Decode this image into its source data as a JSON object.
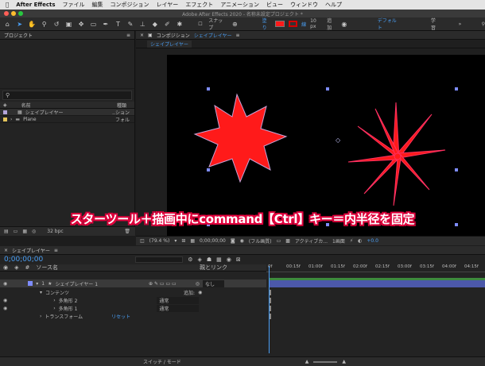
{
  "menubar": {
    "apple": "",
    "app": "After Effects",
    "items": [
      "ファイル",
      "編集",
      "コンポジション",
      "レイヤー",
      "エフェクト",
      "アニメーション",
      "ビュー",
      "ウィンドウ",
      "ヘルプ"
    ]
  },
  "title": "Adobe After Effects 2020 - 名称未設定プロジェクト *",
  "toolbar": {
    "snap": "スナップ",
    "fill_label": "塗り",
    "stroke_label": "線",
    "stroke_width": "10 px",
    "add_label": "追加",
    "workspace_default": "デフォルト",
    "workspace_learn": "学習",
    "fill_color": "#ff1a1a",
    "stroke_color": "#d40000"
  },
  "project": {
    "title": "プロジェクト",
    "search_placeholder": "",
    "col_name": "名前",
    "col_type": "種類",
    "items": [
      {
        "name": "シェイプレイヤー",
        "type": "..ション"
      },
      {
        "name": "Plane",
        "type": "フォル"
      }
    ],
    "bpc": "32 bpc"
  },
  "comp": {
    "title": "コンポジション",
    "name": "シェイプレイヤー",
    "tab": "シェイプレイヤー",
    "zoom": "(79.4 %)",
    "timecode": "0;00;00;00",
    "quality": "(フル画質)",
    "camera": "アクティブカ...",
    "views": "1画面",
    "offset": "+0.0"
  },
  "overlay": "スターツール＋描画中にcommand【Ctrl】キー＝内半径を固定",
  "timeline": {
    "tab": "シェイプレイヤー",
    "timecode": "0;00;00;00",
    "col_source": "ソース名",
    "col_parent": "親とリンク",
    "layer_num": "1",
    "layer_name": "シェイプレイヤー 1",
    "parent": "なし",
    "contents": "コンテンツ",
    "add": "追加:",
    "shape2": "多角形 2",
    "shape1": "多角形 1",
    "blend": "通常",
    "transform": "トランスフォーム",
    "reset": "リセット",
    "switch_mode": "スイッチ / モード",
    "ruler": [
      "0f",
      "00:15f",
      "01:00f",
      "01:15f",
      "02:00f",
      "02:15f",
      "03:00f",
      "03:15f",
      "04:00f",
      "04:15f"
    ]
  }
}
